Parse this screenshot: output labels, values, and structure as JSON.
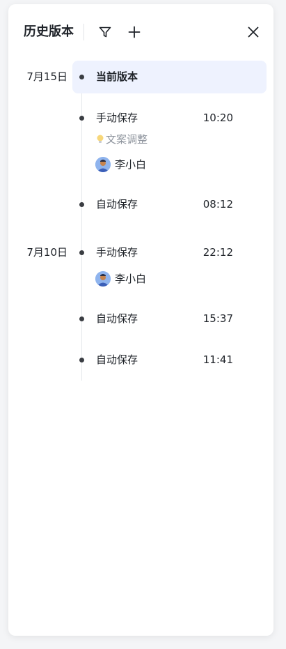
{
  "panel": {
    "title": "历史版本",
    "icons": {
      "filter": "filter-icon",
      "add": "plus-icon",
      "close": "close-icon"
    }
  },
  "groups": [
    {
      "date": "7月15日",
      "entries": [
        {
          "label": "当前版本",
          "time": "",
          "current": true
        },
        {
          "label": "手动保存",
          "time": "10:20",
          "note": "文案调整",
          "user": "李小白"
        },
        {
          "label": "自动保存",
          "time": "08:12"
        }
      ]
    },
    {
      "date": "7月10日",
      "entries": [
        {
          "label": "手动保存",
          "time": "22:12",
          "user": "李小白"
        },
        {
          "label": "自动保存",
          "time": "15:37"
        },
        {
          "label": "自动保存",
          "time": "11:41"
        }
      ]
    }
  ],
  "colors": {
    "current_highlight": "#eef2fe",
    "text_primary": "#1f2329",
    "text_secondary": "#8f959e"
  }
}
